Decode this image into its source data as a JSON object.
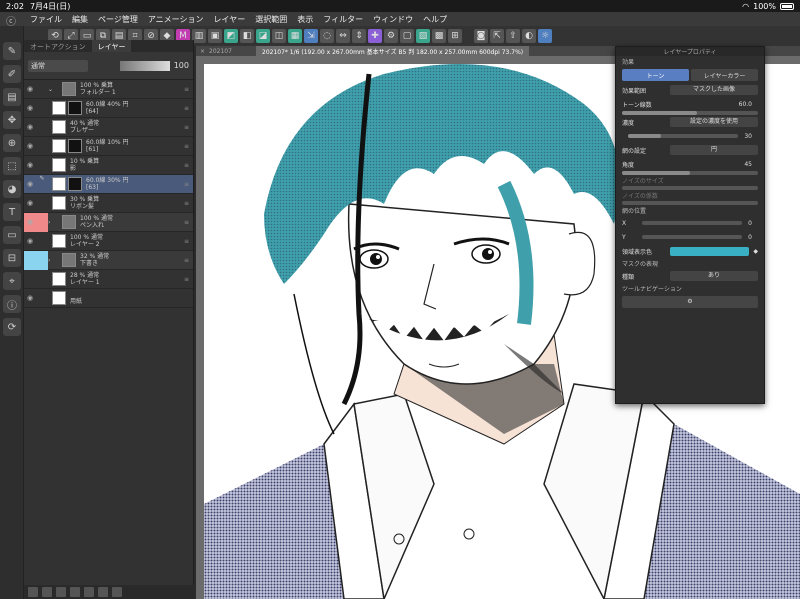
{
  "status": {
    "time": "2:02",
    "date": "7月4日(日)",
    "battery": "100%"
  },
  "menu": [
    "ファイル",
    "編集",
    "ページ管理",
    "アニメーション",
    "レイヤー",
    "選択範囲",
    "表示",
    "フィルター",
    "ウィンドウ",
    "ヘルプ"
  ],
  "layer_panel": {
    "tabs": [
      "オートアクション",
      "レイヤー"
    ],
    "blend_mode": "通常",
    "opacity": "100",
    "layers": [
      {
        "line1": "100 % 乗算",
        "line2": "フォルダー 1",
        "selected": false,
        "tag": ""
      },
      {
        "line1": "60.0線 40% 円",
        "line2": "[64]",
        "selected": false,
        "tag": ""
      },
      {
        "line1": "40 % 通常",
        "line2": "ブレザー",
        "selected": false,
        "tag": ""
      },
      {
        "line1": "60.0線 10% 円",
        "line2": "[61]",
        "selected": false,
        "tag": ""
      },
      {
        "line1": "10 % 乗算",
        "line2": "影",
        "selected": false,
        "tag": ""
      },
      {
        "line1": "60.0線 30% 円",
        "line2": "[63]",
        "selected": true,
        "tag": ""
      },
      {
        "line1": "30 % 乗算",
        "line2": "リボン髪",
        "selected": false,
        "tag": ""
      },
      {
        "line1": "100 % 通常",
        "line2": "ペン入れ",
        "selected": false,
        "tag": "#f08a8a"
      },
      {
        "line1": "100 % 通常",
        "line2": "レイヤー 2",
        "selected": false,
        "tag": ""
      },
      {
        "line1": "32 % 通常",
        "line2": "下書き",
        "selected": false,
        "tag": "#8ad4f0"
      },
      {
        "line1": "28 % 通常",
        "line2": "レイヤー 1",
        "selected": false,
        "tag": ""
      },
      {
        "line1": "",
        "line2": "用紙",
        "selected": false,
        "tag": ""
      }
    ]
  },
  "canvas": {
    "tab_label": "202107",
    "info": "202107* 1/6 (192.00 x 267.00mm 基本サイズ B5 判 182.00 x 257.00mm 600dpi 73.7%)"
  },
  "properties": {
    "title": "レイヤープロパティ",
    "effect_label": "効果",
    "tone_btn": "トーン",
    "layer_color_btn": "レイヤーカラー",
    "effect_range_label": "効果範囲",
    "effect_range_value": "マスクした画像",
    "tone_freq_label": "トーン線数",
    "tone_freq_value": "60.0",
    "density_label": "濃度",
    "density_value": "設定の濃度を使用",
    "density_number": "30",
    "dot_setting_label": "網の設定",
    "dot_shape": "円",
    "angle_label": "角度",
    "angle_value": "45",
    "noise_size_label": "ノイズのサイズ",
    "noise_factor_label": "ノイズの係数",
    "dot_pos_label": "網の位置",
    "x_label": "X",
    "x_value": "0",
    "y_label": "Y",
    "y_value": "0",
    "area_color_label": "領域表示色",
    "area_color": "#3ab0c4",
    "mask_label": "マスクの表現",
    "mask_sub_label": "種類",
    "mask_value": "あり",
    "tool_nav_label": "ツールナビゲーション"
  }
}
